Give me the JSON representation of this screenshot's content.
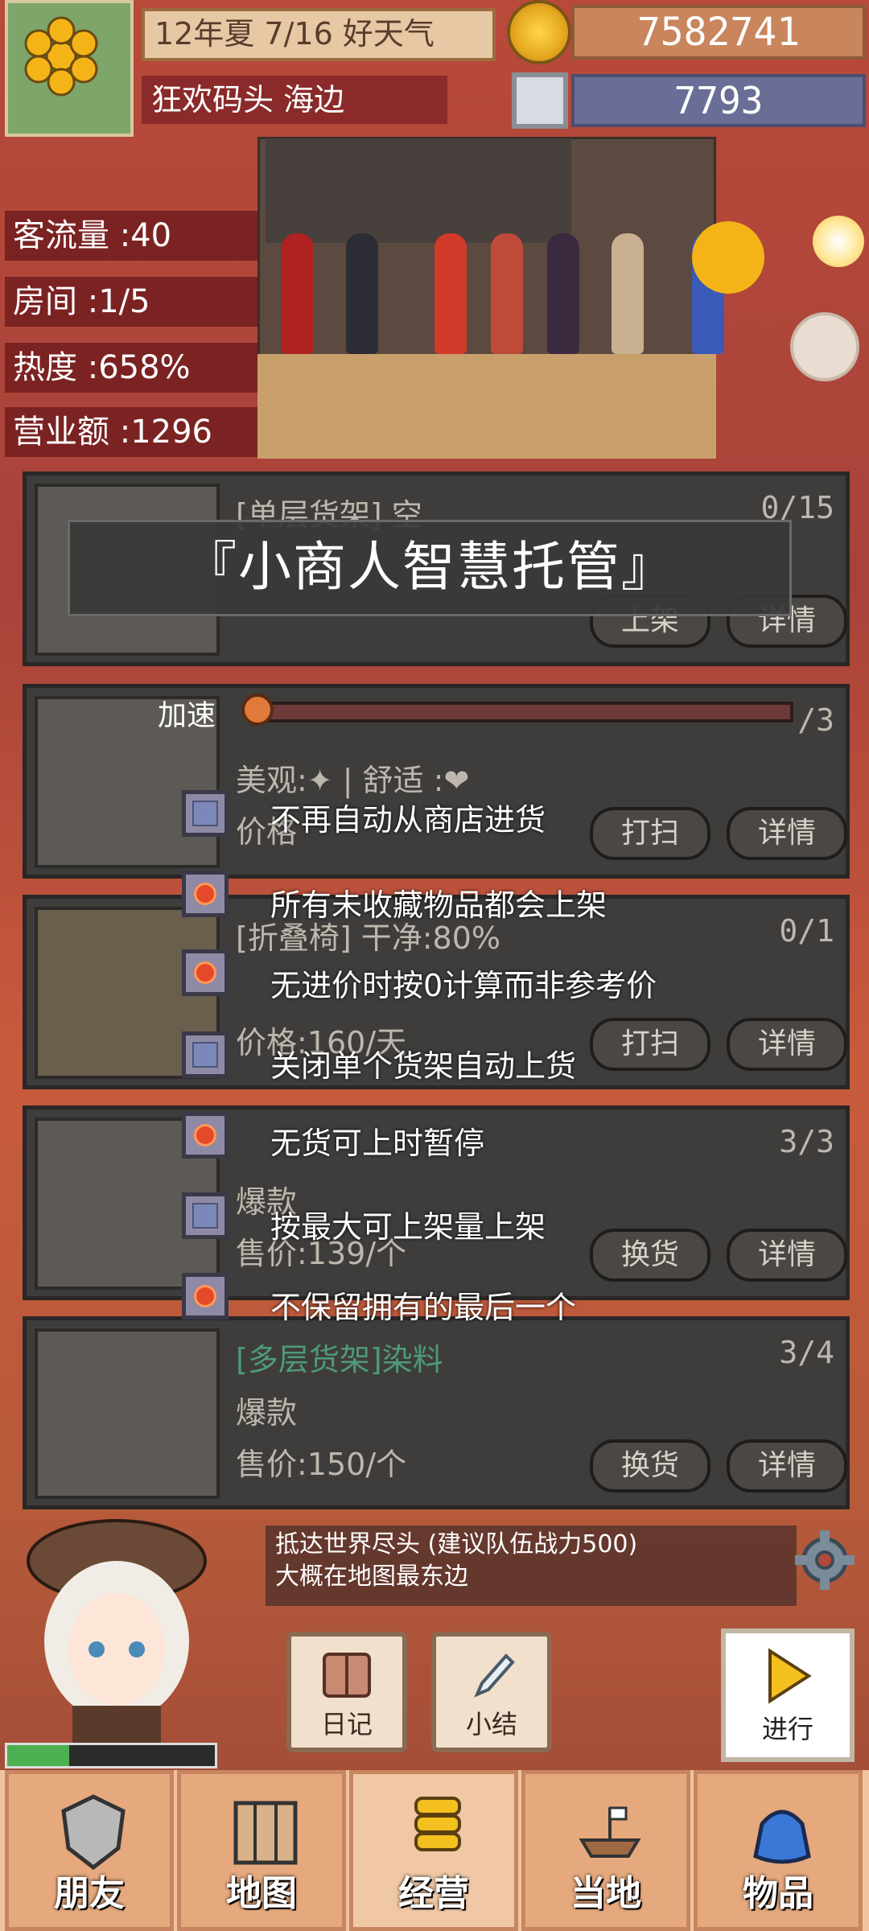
{
  "hud": {
    "date": "12年夏 7/16 好天气",
    "location": "狂欢码头 海边",
    "gold": "7582741",
    "silver": "7793"
  },
  "stats": [
    {
      "label": "客流量 :40"
    },
    {
      "label": "房间 :1/5"
    },
    {
      "label": "热度 :658%"
    },
    {
      "label": "营业额 :1296"
    }
  ],
  "shelves": [
    {
      "title": "[单层货架] 空",
      "count": "0/15",
      "lines": [],
      "btn1": "上架",
      "btn2": "详情"
    },
    {
      "title": "",
      "count": "/3",
      "lines": [
        "美观:✦ | 舒适 :❤",
        "价格"
      ],
      "btn1": "打扫",
      "btn2": "详情"
    },
    {
      "title": "[折叠椅] 干净:80%",
      "count": "0/1",
      "lines": [
        "",
        "价格:160/天"
      ],
      "btn1": "打扫",
      "btn2": "详情"
    },
    {
      "title": "",
      "count": "3/3",
      "lines": [
        "爆款",
        "售价:139/个"
      ],
      "btn1": "换货",
      "btn2": "详情"
    },
    {
      "title": "[多层货架]染料",
      "count": "3/4",
      "lines": [
        "爆款",
        "售价:150/个"
      ],
      "btn1": "换货",
      "btn2": "详情"
    }
  ],
  "overlay": {
    "title": "『小商人智慧托管』",
    "speed_label": "加速",
    "speed_level": 0.0,
    "options": [
      {
        "label": "不再自动从商店进货",
        "checked": false
      },
      {
        "label": "所有未收藏物品都会上架",
        "checked": true
      },
      {
        "label": "无进价时按0计算而非参考价",
        "checked": true
      },
      {
        "label": "关闭单个货架自动上货",
        "checked": false
      },
      {
        "label": "无货可上时暂停",
        "checked": true
      },
      {
        "label": "按最大可上架量上架",
        "checked": false
      },
      {
        "label": "不保留拥有的最后一个",
        "checked": true
      }
    ]
  },
  "tip": {
    "line1": "抵达世界尽头 (建议队伍战力500)",
    "line2": "大概在地图最东边"
  },
  "actions": {
    "diary": "日记",
    "summary": "小结",
    "next": "进行"
  },
  "hp": {
    "fraction": 0.3
  },
  "nav": [
    {
      "label": "朋友",
      "icon": "shield-icon",
      "active": false
    },
    {
      "label": "地图",
      "icon": "map-icon",
      "active": false
    },
    {
      "label": "经营",
      "icon": "coins-icon",
      "active": true
    },
    {
      "label": "当地",
      "icon": "boat-icon",
      "active": false
    },
    {
      "label": "物品",
      "icon": "bag-icon",
      "active": false
    }
  ]
}
